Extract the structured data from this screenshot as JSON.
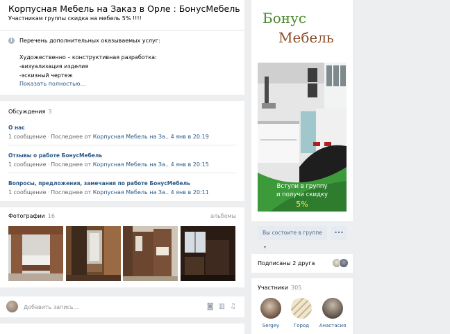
{
  "header": {
    "title": "Корпусная Мебель на Заказ в Орле : БонусМебель",
    "status": "Участникам группы скидка на мебель 5% !!!!"
  },
  "info": {
    "icon": "info-icon",
    "line1": "Перечень дополнительных оказываемых услуг:",
    "line2": "Художественно – конструктивная разработка:",
    "line3": "-визуализация изделия",
    "line4": "-эскизный чертеж",
    "show_more": "Показать полностью…"
  },
  "discussions": {
    "title": "Обсуждения",
    "count": "3",
    "topics": [
      {
        "name": "О нас",
        "messages": "1 сообщение",
        "last_label": "Последнее от",
        "author": "Корпусная Мебель на За..",
        "date": "4 янв в 20:19"
      },
      {
        "name": "Отзывы о работе БонусМебель",
        "messages": "1 сообщение",
        "last_label": "Последнее от",
        "author": "Корпусная Мебель на За..",
        "date": "4 янв в 20:15"
      },
      {
        "name": "Вопросы, предложения, замечания по работе БонусМебель",
        "messages": "1 сообщение",
        "last_label": "Последнее от",
        "author": "Корпусная Мебель на За..",
        "date": "4 янв в 20:11"
      }
    ]
  },
  "photos": {
    "title": "Фотографии",
    "count": "16",
    "albums_link": "альбомы"
  },
  "post_box": {
    "placeholder": "Добавить запись...",
    "icons": [
      "camera-icon",
      "video-icon",
      "music-icon"
    ]
  },
  "cover": {
    "brand_line1": "Бонус",
    "brand_line2": "Мебель",
    "banner_text1": "Вступи в группу",
    "banner_text2": "и получи скидку",
    "banner_percent": "5%",
    "member_button": "Вы состоите в группе",
    "more_button": "•••"
  },
  "friends": {
    "label": "Подписаны 2 друга"
  },
  "members": {
    "title": "Участники",
    "count": "305",
    "people": [
      {
        "name": "Sergey"
      },
      {
        "name": "Город"
      },
      {
        "name": "Анастасия"
      }
    ]
  },
  "colors": {
    "background": "#edeef0",
    "link": "#2a5885",
    "muted": "#939393",
    "brand_green": "#4b8a2c",
    "brand_brown": "#8a4a24"
  }
}
